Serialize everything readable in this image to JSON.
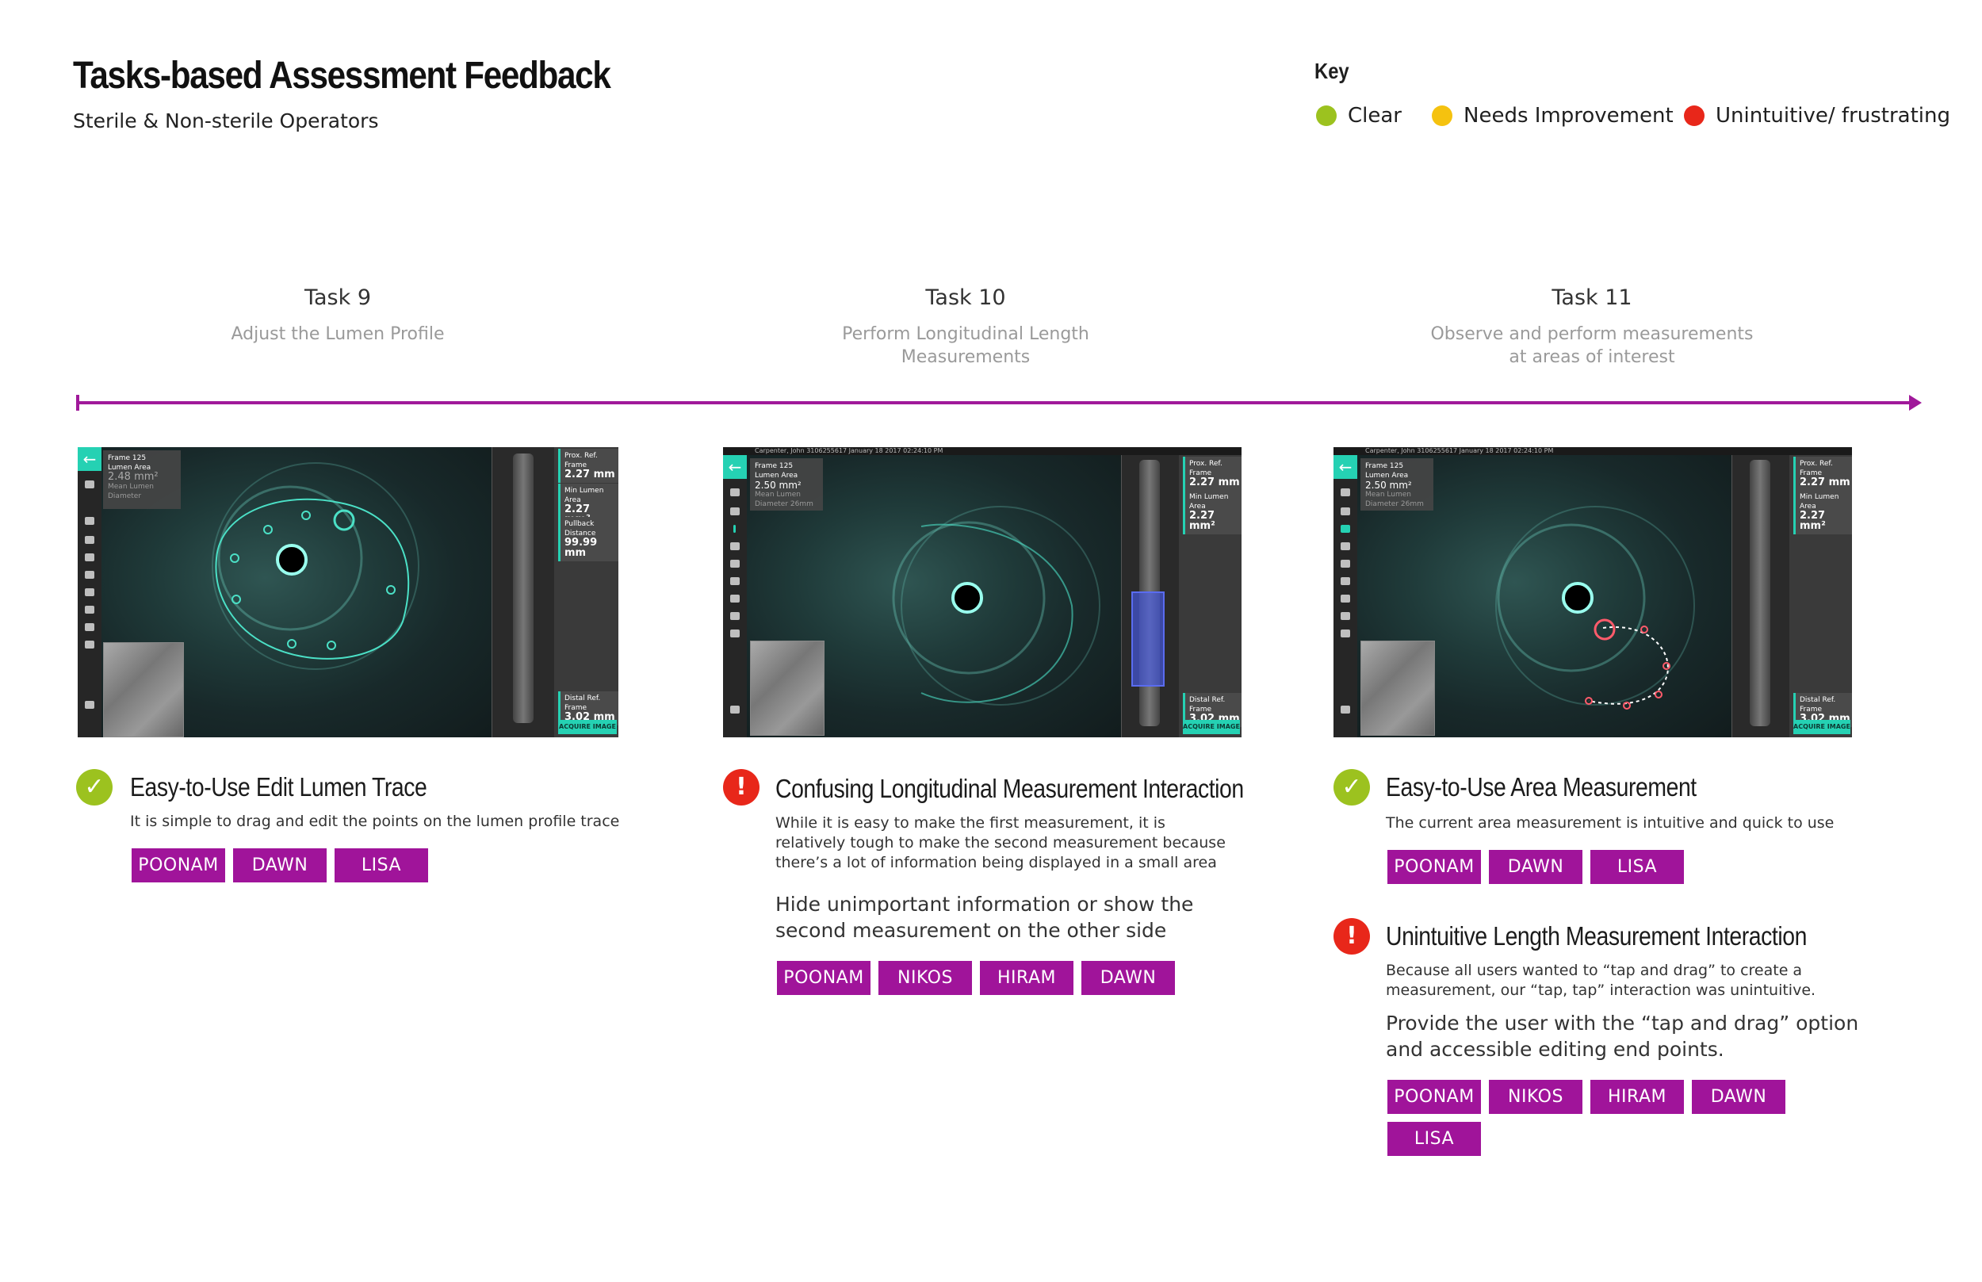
{
  "header": {
    "title": "Tasks-based Assessment Feedback",
    "subtitle": "Sterile & Non-sterile Operators"
  },
  "key": {
    "title": "Key",
    "items": [
      {
        "label": "Clear",
        "color": "#9cc21f"
      },
      {
        "label": "Needs Improvement",
        "color": "#f5c20f"
      },
      {
        "label": "Unintuitive/ frustrating",
        "color": "#e8271a"
      }
    ]
  },
  "colors": {
    "accent": "#a0149a",
    "teal": "#25d1b3"
  },
  "tasks": [
    {
      "number": "Task 9",
      "description": "Adjust the Lumen Profile",
      "screen": {
        "topbar": "",
        "info_frame": "Frame 125",
        "info_label": "Lumen Area",
        "info_value": "2.48 mm²",
        "info_sub": "Mean Lumen Diameter",
        "boxes": [
          {
            "label": "Prox. Ref. Frame",
            "value": "2.27 mm"
          },
          {
            "label": "Min Lumen Area",
            "value": "2.27 mm²"
          },
          {
            "label": "Pullback Distance",
            "value": "99.99 mm"
          }
        ],
        "bottom_box": {
          "label": "Distal Ref. Frame",
          "value": "3.02 mm"
        },
        "acquire": "ACQUIRE IMAGE"
      },
      "feedback": [
        {
          "status": "clear",
          "icon": "check-icon",
          "title": "Easy-to-Use Edit Lumen Trace",
          "body": "It is simple to drag and edit the points on the lumen profile trace",
          "suggestion": "",
          "users": [
            "POONAM",
            "DAWN",
            "LISA"
          ]
        }
      ]
    },
    {
      "number": "Task 10",
      "description": "Perform Longitudinal Length Measurements",
      "screen": {
        "topbar": "Carpenter, John      3106255617                                       January 18 2017 02:24:10 PM",
        "info_frame": "Frame 125",
        "info_label": "Lumen Area",
        "info_value": "2.50 mm²",
        "info_sub": "Mean Lumen Diameter 26mm",
        "boxes": [
          {
            "label": "Prox. Ref. Frame",
            "value": "2.27 mm"
          },
          {
            "label": "Min Lumen Area",
            "value": "2.27 mm²"
          }
        ],
        "bottom_box": {
          "label": "Distal Ref. Frame",
          "value": "3.02 mm"
        },
        "acquire": "ACQUIRE IMAGE"
      },
      "feedback": [
        {
          "status": "unintuitive",
          "icon": "exclamation-icon",
          "title": "Confusing Longitudinal Measurement Interaction",
          "body": "While it is easy to make the first measurement, it is relatively tough to make the second measurement because there’s a lot of information being displayed in a small area",
          "suggestion": "Hide unimportant information or show the second measurement on the other side",
          "users": [
            "POONAM",
            "NIKOS",
            "HIRAM",
            "DAWN"
          ]
        }
      ]
    },
    {
      "number": "Task 11",
      "description": "Observe and perform measurements at areas of interest",
      "screen": {
        "topbar": "Carpenter, John      3106255617                                       January 18 2017 02:24:10 PM",
        "info_frame": "Frame 125",
        "info_label": "Lumen Area",
        "info_value": "2.50 mm²",
        "info_sub": "Mean Lumen Diameter 26mm",
        "boxes": [
          {
            "label": "Prox. Ref. Frame",
            "value": "2.27 mm"
          },
          {
            "label": "Min Lumen Area",
            "value": "2.27 mm²"
          }
        ],
        "bottom_box": {
          "label": "Distal Ref. Frame",
          "value": "3.02 mm"
        },
        "acquire": "ACQUIRE IMAGE"
      },
      "feedback": [
        {
          "status": "clear",
          "icon": "check-icon",
          "title": "Easy-to-Use Area Measurement",
          "body": "The current area measurement is intuitive and quick to use",
          "suggestion": "",
          "users": [
            "POONAM",
            "DAWN",
            "LISA"
          ]
        },
        {
          "status": "unintuitive",
          "icon": "exclamation-icon",
          "title": "Unintuitive Length Measurement Interaction",
          "body": "Because all users wanted to “tap and drag” to create a measurement, our “tap, tap” interaction was unintuitive.",
          "suggestion": "Provide the user with the “tap and drag” option and accessible editing end points.",
          "users": [
            "POONAM",
            "NIKOS",
            "HIRAM",
            "DAWN",
            "LISA"
          ]
        }
      ]
    }
  ]
}
